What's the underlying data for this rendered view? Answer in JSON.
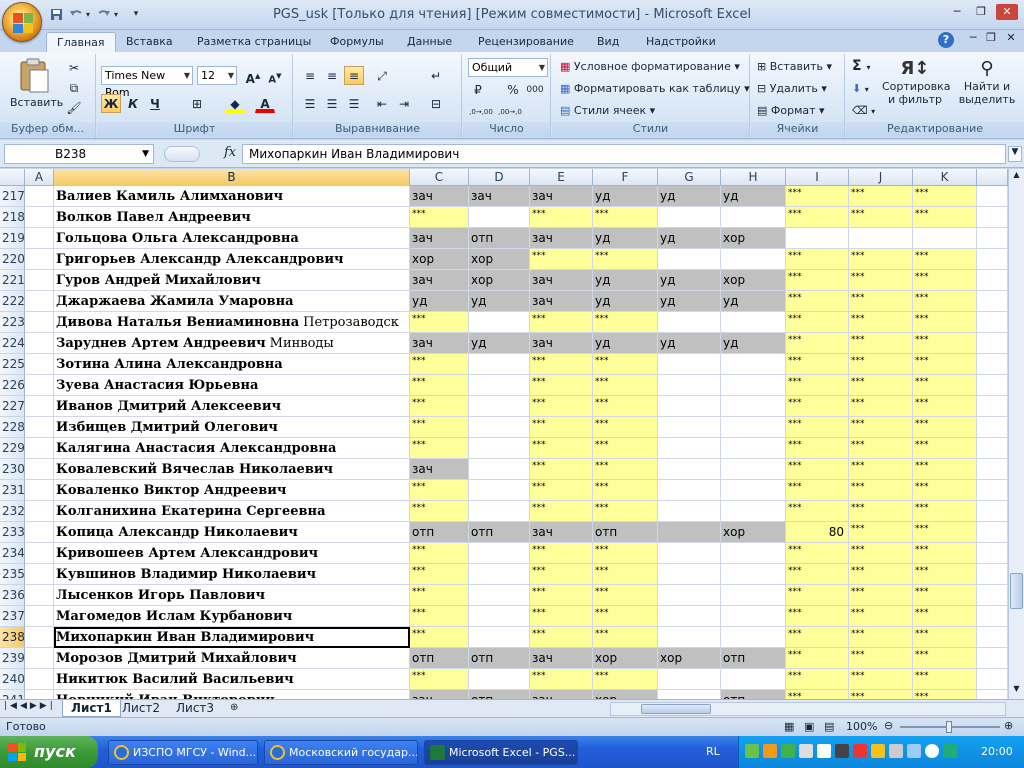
{
  "window": {
    "title": "PGS_usk  [Только для чтения]  [Режим совместимости] - Microsoft Excel",
    "minimize_label": "─",
    "restore_label": "❐",
    "close_label": "✕"
  },
  "quick_access": {
    "save_icon": "save-icon",
    "undo_icon": "undo-icon",
    "redo_icon": "redo-icon",
    "customize_glyph": "▾"
  },
  "tabs": [
    {
      "label": "Главная",
      "active": true
    },
    {
      "label": "Вставка"
    },
    {
      "label": "Разметка страницы"
    },
    {
      "label": "Формулы"
    },
    {
      "label": "Данные"
    },
    {
      "label": "Рецензирование"
    },
    {
      "label": "Вид"
    },
    {
      "label": "Надстройки"
    }
  ],
  "ribbon": {
    "clipboard": {
      "label": "Буфер обм...",
      "paste": "Вставить"
    },
    "font": {
      "label": "Шрифт",
      "name": "Times New Rom",
      "size": "12",
      "bold": "Ж",
      "italic": "К",
      "underline": "Ч",
      "grow": "A",
      "shrink": "A"
    },
    "alignment": {
      "label": "Выравнивание"
    },
    "number": {
      "label": "Число",
      "format": "Общий",
      "percent": "%",
      "thousands": "000",
      "inc_decimal": ",0→,00",
      "dec_decimal": ",00→,0"
    },
    "styles": {
      "label": "Стили",
      "conditional": "Условное форматирование",
      "as_table": "Форматировать как таблицу",
      "cell_styles": "Стили ячеек"
    },
    "cells": {
      "label": "Ячейки",
      "insert": "Вставить",
      "delete": "Удалить",
      "format": "Формат"
    },
    "editing": {
      "label": "Редактирование",
      "sum_glyph": "Σ",
      "sort": "Сортировка",
      "sort2": "и фильтр",
      "find": "Найти и",
      "find2": "выделить"
    }
  },
  "formula_bar": {
    "name_box": "B238",
    "fx": "fx",
    "value": "Михопаркин Иван Владимирович"
  },
  "colors": {
    "yellow": "#ffff99",
    "gray": "#c0c0c0",
    "accent": "#f6c862"
  },
  "columns": [
    "A",
    "B",
    "C",
    "D",
    "E",
    "F",
    "G",
    "H",
    "I",
    "J",
    "K"
  ],
  "selected_column": "B",
  "selected_row": "238",
  "rows": [
    {
      "n": "217",
      "name": "Валиев Камиль Алимханович",
      "suffix": "",
      "cells": [
        [
          "зач",
          "g"
        ],
        [
          "зач",
          "g"
        ],
        [
          "зач",
          "g"
        ],
        [
          "уд",
          "g"
        ],
        [
          "уд",
          "g"
        ],
        [
          "уд",
          "g"
        ],
        [
          "***",
          "y"
        ],
        [
          "***",
          "y"
        ],
        [
          "***",
          "y"
        ]
      ]
    },
    {
      "n": "218",
      "name": "Волков Павел Андреевич",
      "suffix": "",
      "cells": [
        [
          "***",
          "y"
        ],
        [
          "",
          ""
        ],
        [
          "***",
          "y"
        ],
        [
          "***",
          "y"
        ],
        [
          "",
          ""
        ],
        [
          "",
          ""
        ],
        [
          "***",
          "y"
        ],
        [
          "***",
          "y"
        ],
        [
          "***",
          "y"
        ]
      ]
    },
    {
      "n": "219",
      "name": "Гольцова Ольга Александровна",
      "suffix": "",
      "cells": [
        [
          "зач",
          "g"
        ],
        [
          "отп",
          "g"
        ],
        [
          "зач",
          "g"
        ],
        [
          "уд",
          "g"
        ],
        [
          "уд",
          "g"
        ],
        [
          "хор",
          "g"
        ],
        [
          "",
          ""
        ],
        [
          "",
          ""
        ],
        [
          "",
          ""
        ]
      ]
    },
    {
      "n": "220",
      "name": "Григорьев Александр Александрович",
      "suffix": "",
      "cells": [
        [
          "хор",
          "g"
        ],
        [
          "хор",
          "g"
        ],
        [
          "***",
          "y"
        ],
        [
          "***",
          "y"
        ],
        [
          "",
          ""
        ],
        [
          "",
          ""
        ],
        [
          "***",
          "y"
        ],
        [
          "***",
          "y"
        ],
        [
          "***",
          "y"
        ]
      ]
    },
    {
      "n": "221",
      "name": "Гуров Андрей Михайлович",
      "suffix": "",
      "cells": [
        [
          "зач",
          "g"
        ],
        [
          "хор",
          "g"
        ],
        [
          "зач",
          "g"
        ],
        [
          "уд",
          "g"
        ],
        [
          "уд",
          "g"
        ],
        [
          "хор",
          "g"
        ],
        [
          "***",
          "y"
        ],
        [
          "***",
          "y"
        ],
        [
          "***",
          "y"
        ]
      ]
    },
    {
      "n": "222",
      "name": "Джаржаева Жамила Умаровна",
      "suffix": "",
      "cells": [
        [
          "уд",
          "g"
        ],
        [
          "уд",
          "g"
        ],
        [
          "зач",
          "g"
        ],
        [
          "уд",
          "g"
        ],
        [
          "уд",
          "g"
        ],
        [
          "уд",
          "g"
        ],
        [
          "***",
          "y"
        ],
        [
          "***",
          "y"
        ],
        [
          "***",
          "y"
        ]
      ]
    },
    {
      "n": "223",
      "name": "Дивова Наталья Вениаминовна",
      "suffix": "Петрозаводск",
      "cells": [
        [
          "***",
          "y"
        ],
        [
          "",
          ""
        ],
        [
          "***",
          "y"
        ],
        [
          "***",
          "y"
        ],
        [
          "",
          ""
        ],
        [
          "",
          ""
        ],
        [
          "***",
          "y"
        ],
        [
          "***",
          "y"
        ],
        [
          "***",
          "y"
        ]
      ]
    },
    {
      "n": "224",
      "name": "Заруднев Артем Андреевич",
      "suffix": "Минводы",
      "cells": [
        [
          "зач",
          "g"
        ],
        [
          "уд",
          "g"
        ],
        [
          "зач",
          "g"
        ],
        [
          "уд",
          "g"
        ],
        [
          "уд",
          "g"
        ],
        [
          "уд",
          "g"
        ],
        [
          "***",
          "y"
        ],
        [
          "***",
          "y"
        ],
        [
          "***",
          "y"
        ]
      ]
    },
    {
      "n": "225",
      "name": "Зотина Алина Александровна",
      "suffix": "",
      "cells": [
        [
          "***",
          "y"
        ],
        [
          "",
          ""
        ],
        [
          "***",
          "y"
        ],
        [
          "***",
          "y"
        ],
        [
          "",
          ""
        ],
        [
          "",
          ""
        ],
        [
          "***",
          "y"
        ],
        [
          "***",
          "y"
        ],
        [
          "***",
          "y"
        ]
      ]
    },
    {
      "n": "226",
      "name": "Зуева Анастасия Юрьевна",
      "suffix": "",
      "cells": [
        [
          "***",
          "y"
        ],
        [
          "",
          ""
        ],
        [
          "***",
          "y"
        ],
        [
          "***",
          "y"
        ],
        [
          "",
          ""
        ],
        [
          "",
          ""
        ],
        [
          "***",
          "y"
        ],
        [
          "***",
          "y"
        ],
        [
          "***",
          "y"
        ]
      ]
    },
    {
      "n": "227",
      "name": "Иванов Дмитрий Алексеевич",
      "suffix": "",
      "cells": [
        [
          "***",
          "y"
        ],
        [
          "",
          ""
        ],
        [
          "***",
          "y"
        ],
        [
          "***",
          "y"
        ],
        [
          "",
          ""
        ],
        [
          "",
          ""
        ],
        [
          "***",
          "y"
        ],
        [
          "***",
          "y"
        ],
        [
          "***",
          "y"
        ]
      ]
    },
    {
      "n": "228",
      "name": "Избищев Дмитрий Олегович",
      "suffix": "",
      "cells": [
        [
          "***",
          "y"
        ],
        [
          "",
          ""
        ],
        [
          "***",
          "y"
        ],
        [
          "***",
          "y"
        ],
        [
          "",
          ""
        ],
        [
          "",
          ""
        ],
        [
          "***",
          "y"
        ],
        [
          "***",
          "y"
        ],
        [
          "***",
          "y"
        ]
      ]
    },
    {
      "n": "229",
      "name": "Калягина Анастасия Александровна",
      "suffix": "",
      "cells": [
        [
          "***",
          "y"
        ],
        [
          "",
          ""
        ],
        [
          "***",
          "y"
        ],
        [
          "***",
          "y"
        ],
        [
          "",
          ""
        ],
        [
          "",
          ""
        ],
        [
          "***",
          "y"
        ],
        [
          "***",
          "y"
        ],
        [
          "***",
          "y"
        ]
      ]
    },
    {
      "n": "230",
      "name": "Ковалевский Вячеслав Николаевич",
      "suffix": "",
      "cells": [
        [
          "зач",
          "g"
        ],
        [
          "",
          ""
        ],
        [
          "***",
          "y"
        ],
        [
          "***",
          "y"
        ],
        [
          "",
          ""
        ],
        [
          "",
          ""
        ],
        [
          "***",
          "y"
        ],
        [
          "***",
          "y"
        ],
        [
          "***",
          "y"
        ]
      ]
    },
    {
      "n": "231",
      "name": "Коваленко Виктор Андреевич",
      "suffix": "",
      "cells": [
        [
          "***",
          "y"
        ],
        [
          "",
          ""
        ],
        [
          "***",
          "y"
        ],
        [
          "***",
          "y"
        ],
        [
          "",
          ""
        ],
        [
          "",
          ""
        ],
        [
          "***",
          "y"
        ],
        [
          "***",
          "y"
        ],
        [
          "***",
          "y"
        ]
      ]
    },
    {
      "n": "232",
      "name": "Колганихина Екатерина Сергеевна",
      "suffix": "",
      "cells": [
        [
          "***",
          "y"
        ],
        [
          "",
          ""
        ],
        [
          "***",
          "y"
        ],
        [
          "***",
          "y"
        ],
        [
          "",
          ""
        ],
        [
          "",
          ""
        ],
        [
          "***",
          "y"
        ],
        [
          "***",
          "y"
        ],
        [
          "***",
          "y"
        ]
      ]
    },
    {
      "n": "233",
      "name": "Копица Александр Николаевич",
      "suffix": "",
      "cells": [
        [
          "отп",
          "g"
        ],
        [
          "отп",
          "g"
        ],
        [
          "зач",
          "g"
        ],
        [
          "отп",
          "g"
        ],
        [
          "",
          "g"
        ],
        [
          "хор",
          "g"
        ],
        [
          "80",
          "yn"
        ],
        [
          "***",
          "y"
        ],
        [
          "***",
          "y"
        ]
      ]
    },
    {
      "n": "234",
      "name": "Кривошеев Артем Александрович",
      "suffix": "",
      "cells": [
        [
          "***",
          "y"
        ],
        [
          "",
          ""
        ],
        [
          "***",
          "y"
        ],
        [
          "***",
          "y"
        ],
        [
          "",
          ""
        ],
        [
          "",
          ""
        ],
        [
          "***",
          "y"
        ],
        [
          "***",
          "y"
        ],
        [
          "***",
          "y"
        ]
      ]
    },
    {
      "n": "235",
      "name": "Кувшинов Владимир Николаевич",
      "suffix": "",
      "cells": [
        [
          "***",
          "y"
        ],
        [
          "",
          ""
        ],
        [
          "***",
          "y"
        ],
        [
          "***",
          "y"
        ],
        [
          "",
          ""
        ],
        [
          "",
          ""
        ],
        [
          "***",
          "y"
        ],
        [
          "***",
          "y"
        ],
        [
          "***",
          "y"
        ]
      ]
    },
    {
      "n": "236",
      "name": "Лысенков Игорь Павлович",
      "suffix": "",
      "cells": [
        [
          "***",
          "y"
        ],
        [
          "",
          ""
        ],
        [
          "***",
          "y"
        ],
        [
          "***",
          "y"
        ],
        [
          "",
          ""
        ],
        [
          "",
          ""
        ],
        [
          "***",
          "y"
        ],
        [
          "***",
          "y"
        ],
        [
          "***",
          "y"
        ]
      ]
    },
    {
      "n": "237",
      "name": "Магомедов Ислам Курбанович",
      "suffix": "",
      "cells": [
        [
          "***",
          "y"
        ],
        [
          "",
          ""
        ],
        [
          "***",
          "y"
        ],
        [
          "***",
          "y"
        ],
        [
          "",
          ""
        ],
        [
          "",
          ""
        ],
        [
          "***",
          "y"
        ],
        [
          "***",
          "y"
        ],
        [
          "***",
          "y"
        ]
      ]
    },
    {
      "n": "238",
      "name": "Михопаркин Иван Владимирович",
      "suffix": "",
      "cells": [
        [
          "***",
          "y"
        ],
        [
          "",
          ""
        ],
        [
          "***",
          "y"
        ],
        [
          "***",
          "y"
        ],
        [
          "",
          ""
        ],
        [
          "",
          ""
        ],
        [
          "***",
          "y"
        ],
        [
          "***",
          "y"
        ],
        [
          "***",
          "y"
        ]
      ]
    },
    {
      "n": "239",
      "name": "Морозов Дмитрий Михайлович",
      "suffix": "",
      "cells": [
        [
          "отп",
          "g"
        ],
        [
          "отп",
          "g"
        ],
        [
          "зач",
          "g"
        ],
        [
          "хор",
          "g"
        ],
        [
          "хор",
          "g"
        ],
        [
          "отп",
          "g"
        ],
        [
          "***",
          "y"
        ],
        [
          "***",
          "y"
        ],
        [
          "***",
          "y"
        ]
      ]
    },
    {
      "n": "240",
      "name": "Никитюк Василий Васильевич",
      "suffix": "",
      "cells": [
        [
          "***",
          "y"
        ],
        [
          "",
          ""
        ],
        [
          "***",
          "y"
        ],
        [
          "***",
          "y"
        ],
        [
          "",
          ""
        ],
        [
          "",
          ""
        ],
        [
          "***",
          "y"
        ],
        [
          "***",
          "y"
        ],
        [
          "***",
          "y"
        ]
      ]
    },
    {
      "n": "241",
      "name": "Новицкий Иван Викторович",
      "suffix": "",
      "cells": [
        [
          "зач",
          "g"
        ],
        [
          "отп",
          "g"
        ],
        [
          "зач",
          "g"
        ],
        [
          "хор",
          "g"
        ],
        [
          "",
          ""
        ],
        [
          "отп",
          "g"
        ],
        [
          "***",
          "y"
        ],
        [
          "***",
          "y"
        ],
        [
          "***",
          "y"
        ]
      ]
    }
  ],
  "sheet_tabs": [
    {
      "label": "Лист1",
      "active": true
    },
    {
      "label": "Лист2"
    },
    {
      "label": "Лист3"
    }
  ],
  "status": {
    "ready": "Готово",
    "zoom": "100%"
  },
  "taskbar": {
    "start": "пуск",
    "items": [
      {
        "label": "ИЗСПО МГСУ - Wind...",
        "icon": "ie-icon"
      },
      {
        "label": "Московский государ...",
        "icon": "ie-icon"
      },
      {
        "label": "Microsoft Excel - PGS...",
        "icon": "excel-icon",
        "active": true
      }
    ],
    "lang": "RL",
    "clock": "20:00"
  }
}
